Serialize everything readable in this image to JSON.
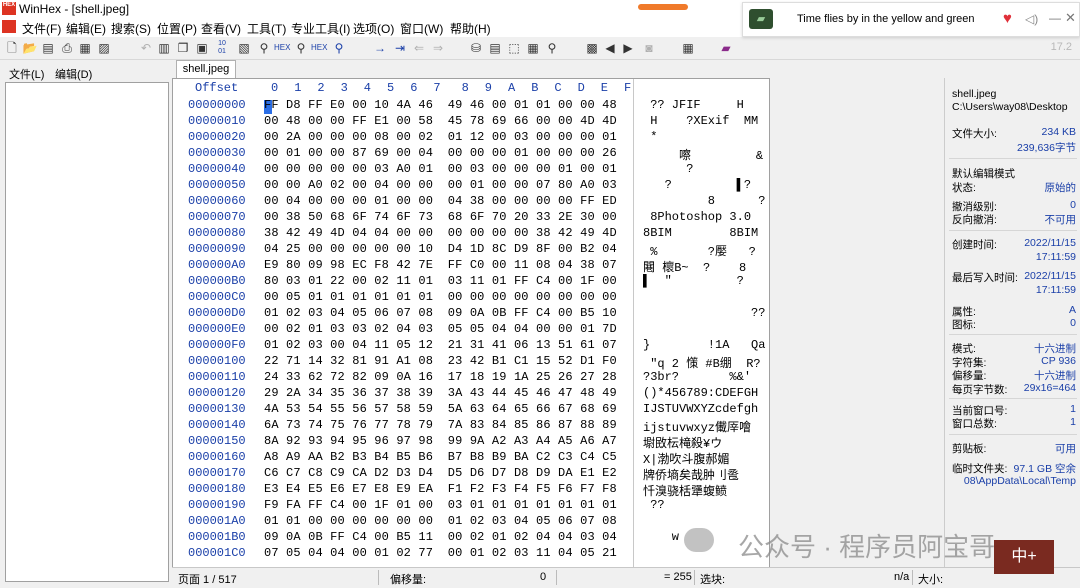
{
  "window": {
    "app_icon_text": "HEX",
    "title": "WinHex - [shell.jpeg]"
  },
  "menu": [
    "文件(F)",
    "编辑(E)",
    "搜索(S)",
    "位置(P)",
    "查看(V)",
    "工具(T)",
    "专业工具(I)",
    "选项(O)",
    "窗口(W)",
    "帮助(H)"
  ],
  "toolbar": {
    "zoom": "17.2"
  },
  "notification": {
    "song": "Time flies by in the yellow and green",
    "close": "✕"
  },
  "left_panel": {
    "menu": [
      "文件(L)",
      "编辑(D)"
    ]
  },
  "tab": {
    "label": "shell.jpeg"
  },
  "hex": {
    "offset_header": "Offset",
    "columns": [
      "0",
      "1",
      "2",
      "3",
      "4",
      "5",
      "6",
      "7",
      "8",
      "9",
      "A",
      "B",
      "C",
      "D",
      "E",
      "F"
    ],
    "rows": [
      {
        "offset": "00000000",
        "bytes": "FF D8 FF E0 00 10 4A 46  49 46 00 01 01 00 00 48",
        "ascii": " ?? JFIF     H"
      },
      {
        "offset": "00000010",
        "bytes": "00 48 00 00 FF E1 00 58  45 78 69 66 00 00 4D 4D",
        "ascii": " H    ?XExif  MM"
      },
      {
        "offset": "00000020",
        "bytes": "00 2A 00 00 00 08 00 02  01 12 00 03 00 00 00 01",
        "ascii": " *"
      },
      {
        "offset": "00000030",
        "bytes": "00 01 00 00 87 69 00 04  00 00 00 01 00 00 00 26",
        "ascii": "     嚓         &"
      },
      {
        "offset": "00000040",
        "bytes": "00 00 00 00 00 03 A0 01  00 03 00 00 00 01 00 01",
        "ascii": "      ?"
      },
      {
        "offset": "00000050",
        "bytes": "00 00 A0 02 00 04 00 00  00 01 00 00 07 80 A0 03",
        "ascii": "   ?         ▌?"
      },
      {
        "offset": "00000060",
        "bytes": "00 04 00 00 00 01 00 00  04 38 00 00 00 00 FF ED",
        "ascii": "         8      ?"
      },
      {
        "offset": "00000070",
        "bytes": "00 38 50 68 6F 74 6F 73  68 6F 70 20 33 2E 30 00",
        "ascii": " 8Photoshop 3.0"
      },
      {
        "offset": "00000080",
        "bytes": "38 42 49 4D 04 04 00 00  00 00 00 00 38 42 49 4D",
        "ascii": "8BIM        8BIM"
      },
      {
        "offset": "00000090",
        "bytes": "04 25 00 00 00 00 00 10  D4 1D 8C D9 8F 00 B2 04",
        "ascii": " %       ?嬮   ?"
      },
      {
        "offset": "000000A0",
        "bytes": "E9 80 09 98 EC F8 42 7E  FF C0 00 11 08 04 38 07",
        "ascii": "闀 櫰B~  ?    8"
      },
      {
        "offset": "000000B0",
        "bytes": "80 03 01 22 00 02 11 01  03 11 01 FF C4 00 1F 00",
        "ascii": "▌  \"         ?"
      },
      {
        "offset": "000000C0",
        "bytes": "00 05 01 01 01 01 01 01  00 00 00 00 00 00 00 00",
        "ascii": ""
      },
      {
        "offset": "000000D0",
        "bytes": "01 02 03 04 05 06 07 08  09 0A 0B FF C4 00 B5 10",
        "ascii": "               ??"
      },
      {
        "offset": "000000E0",
        "bytes": "00 02 01 03 03 02 04 03  05 05 04 04 00 00 01 7D",
        "ascii": ""
      },
      {
        "offset": "000000F0",
        "bytes": "01 02 03 00 04 11 05 12  21 31 41 06 13 51 61 07",
        "ascii": "}        !1A   Qa"
      },
      {
        "offset": "00000100",
        "bytes": "22 71 14 32 81 91 A1 08  23 42 B1 C1 15 52 D1 F0",
        "ascii": " \"q 2 憡 #B绷  R?"
      },
      {
        "offset": "00000110",
        "bytes": "24 33 62 72 82 09 0A 16  17 18 19 1A 25 26 27 28",
        "ascii": "?3br?       %&'"
      },
      {
        "offset": "00000120",
        "bytes": "29 2A 34 35 36 37 38 39  3A 43 44 45 46 47 48 49",
        "ascii": "()*456789:CDEFGH"
      },
      {
        "offset": "00000130",
        "bytes": "4A 53 54 55 56 57 58 59  5A 63 64 65 66 67 68 69",
        "ascii": "IJSTUVWXYZcdefgh"
      },
      {
        "offset": "00000140",
        "bytes": "6A 73 74 75 76 77 78 79  7A 83 84 85 86 87 88 89",
        "ascii": "ijstuvwxyz儎厗噲"
      },
      {
        "offset": "00000150",
        "bytes": "8A 92 93 94 95 96 97 98  99 9A A2 A3 A4 A5 A6 A7",
        "ascii": "墛敃枟槞殺¥ウ"
      },
      {
        "offset": "00000160",
        "bytes": "A8 A9 AA B2 B3 B4 B5 B6  B7 B8 B9 BA C2 C3 C4 C5",
        "ascii": "X|渤吹斗腹郝媚"
      },
      {
        "offset": "00000170",
        "bytes": "C6 C7 C8 C9 CA D2 D3 D4  D5 D6 D7 D8 D9 DA E1 E2",
        "ascii": "牌侨墒矣哉肿刂卺"
      },
      {
        "offset": "00000180",
        "bytes": "E3 E4 E5 E6 E7 E8 E9 EA  F1 F2 F3 F4 F5 F6 F7 F8",
        "ascii": "忏溴骁栝犟蝮鲼"
      },
      {
        "offset": "00000190",
        "bytes": "F9 FA FF C4 00 1F 01 00  03 01 01 01 01 01 01 01",
        "ascii": " ??"
      },
      {
        "offset": "000001A0",
        "bytes": "01 01 00 00 00 00 00 00  01 02 03 04 05 06 07 08",
        "ascii": ""
      },
      {
        "offset": "000001B0",
        "bytes": "09 0A 0B FF C4 00 B5 11  00 02 01 02 04 04 03 04",
        "ascii": "    w"
      },
      {
        "offset": "000001C0",
        "bytes": "07 05 04 04 00 01 02 77  00 01 02 03 11 04 05 21",
        "ascii": ""
      }
    ]
  },
  "info": {
    "filename": "shell.jpeg",
    "path": "C:\\Users\\way08\\Desktop",
    "size_label": "文件大小:",
    "size_kb": "234 KB",
    "size_bytes": "239,636字节",
    "edit_mode_label": "默认编辑模式",
    "state_label": "状态:",
    "state_value": "原始的",
    "undo_level_label": "撤消级别:",
    "undo_level_value": "0",
    "undo_reverse_label": "反向撤消:",
    "undo_reverse_value": "不可用",
    "created_label": "创建时间:",
    "created_date": "2022/11/15",
    "created_time": "17:11:59",
    "modified_label": "最后写入时间:",
    "modified_date": "2022/11/15",
    "modified_time": "17:11:59",
    "attr_label": "属性:",
    "attr_value": "A",
    "icon_label": "图标:",
    "icon_value": "0",
    "mode_label": "模式:",
    "mode_value": "十六进制",
    "charset_label": "字符集:",
    "charset_value": "CP 936",
    "offset_label": "偏移量:",
    "offset_value": "十六进制",
    "bpp_label": "每页字节数:",
    "bpp_value": "29x16=464",
    "cur_window_label": "当前窗口号:",
    "cur_window_value": "1",
    "window_total_label": "窗口总数:",
    "window_total_value": "1",
    "clipboard_label": "剪贴板:",
    "clipboard_value": "可用",
    "temp_label": "临时文件夹:",
    "temp_value": "97.1 GB 空余",
    "temp_path": "08\\AppData\\Local\\Temp"
  },
  "status": {
    "page": "页面 1 / 517",
    "offset_label": "偏移量:",
    "offset_value": "0",
    "value": "= 255",
    "block_label": "选块:",
    "na": "n/a",
    "size_label": "大小:"
  },
  "watermark": {
    "text": "公众号 · 程序员阿宝哥",
    "stamp": "中+"
  },
  "colors": {
    "accent_blue": "#1a3fa8",
    "cursor": "#2b6ee6",
    "heart": "#e0303a"
  }
}
